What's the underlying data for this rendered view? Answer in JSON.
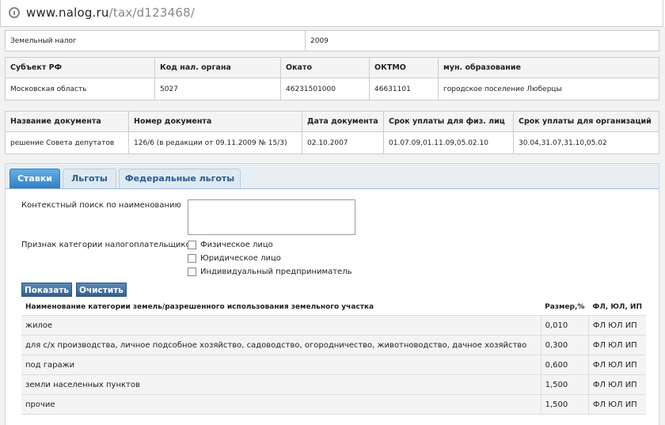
{
  "browser": {
    "url_domain": "www.nalog.ru",
    "url_path": "/tax/d123468/"
  },
  "tax_row": {
    "name": "Земельный налог",
    "year": "2009"
  },
  "region_table": {
    "headers": [
      "Субъект РФ",
      "Код нал. органа",
      "Окато",
      "ОКТМО",
      "мун. образование"
    ],
    "row": [
      "Московская область",
      "5027",
      "46231501000",
      "46631101",
      "городское поселение Люберцы"
    ]
  },
  "doc_table": {
    "headers": [
      "Название документа",
      "Номер документа",
      "Дата документа",
      "Срок уплаты для физ. лиц",
      "Срок уплаты для организаций"
    ],
    "row": [
      "решение Совета депутатов",
      "126/6 (в редакции от 09.11.2009 № 15/3)",
      "02.10.2007",
      "01.07.09,01.11.09,05.02.10",
      "30.04,31.07,31.10,05.02"
    ]
  },
  "tabs": [
    "Ставки",
    "Льготы",
    "Федеральные льготы"
  ],
  "filters": {
    "search_label": "Контекстный поиск по наименованию",
    "search_value": "",
    "category_label": "Признак категории налогоплательщиков",
    "checkboxes": [
      "Физическое лицо",
      "Юридическое лицо",
      "Индивидуальный предприниматель"
    ],
    "show_button": "Показать",
    "clear_button": "Очистить"
  },
  "rates": {
    "headers": [
      "Наименование категории земель/разрешенного использования земельного участка",
      "Размер,%",
      "ФЛ, ЮЛ, ИП"
    ],
    "rows": [
      [
        "жилое",
        "0,010",
        "ФЛ ЮЛ ИП"
      ],
      [
        "для с/х производства, личное подсобное хозяйство, садоводство, огородничество, животноводство, дачное хозяйство",
        "0,300",
        "ФЛ ЮЛ ИП"
      ],
      [
        "под гаражи",
        "0,600",
        "ФЛ ЮЛ ИП"
      ],
      [
        "земли населенных пунктов",
        "1,500",
        "ФЛ ЮЛ ИП"
      ],
      [
        "прочие",
        "1,500",
        "ФЛ ЮЛ ИП"
      ]
    ]
  }
}
